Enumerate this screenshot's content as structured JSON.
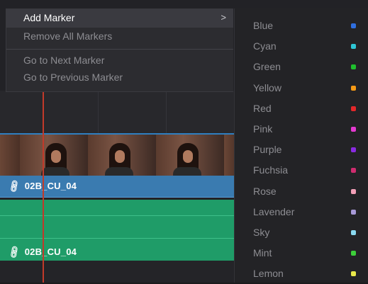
{
  "context_menu": {
    "items": [
      {
        "label": "Add Marker",
        "active": true,
        "has_submenu": true,
        "arrow": ">"
      },
      {
        "label": "Remove All Markers",
        "active": false
      },
      {
        "label": "Go to Next Marker",
        "active": false
      },
      {
        "label": "Go to Previous Marker",
        "active": false
      }
    ]
  },
  "marker_colors": [
    {
      "label": "Blue",
      "color": "#2f6fe0"
    },
    {
      "label": "Cyan",
      "color": "#2ec7d6"
    },
    {
      "label": "Green",
      "color": "#1fbf2e"
    },
    {
      "label": "Yellow",
      "color": "#f59a16"
    },
    {
      "label": "Red",
      "color": "#e3282a"
    },
    {
      "label": "Pink",
      "color": "#e43ad0"
    },
    {
      "label": "Purple",
      "color": "#8a2be2"
    },
    {
      "label": "Fuchsia",
      "color": "#cf2c6f"
    },
    {
      "label": "Rose",
      "color": "#f3a0b8"
    },
    {
      "label": "Lavender",
      "color": "#a89ad8"
    },
    {
      "label": "Sky",
      "color": "#8ad9f0"
    },
    {
      "label": "Mint",
      "color": "#3dcf3a"
    },
    {
      "label": "Lemon",
      "color": "#e9e84a"
    }
  ],
  "timeline": {
    "video_clip_name": "02B_CU_04",
    "audio_clip_name": "02B_CU_04",
    "video_track_color": "#3a7bb0",
    "audio_track_color": "#1f9c68",
    "playhead_color": "#c23a2a"
  }
}
